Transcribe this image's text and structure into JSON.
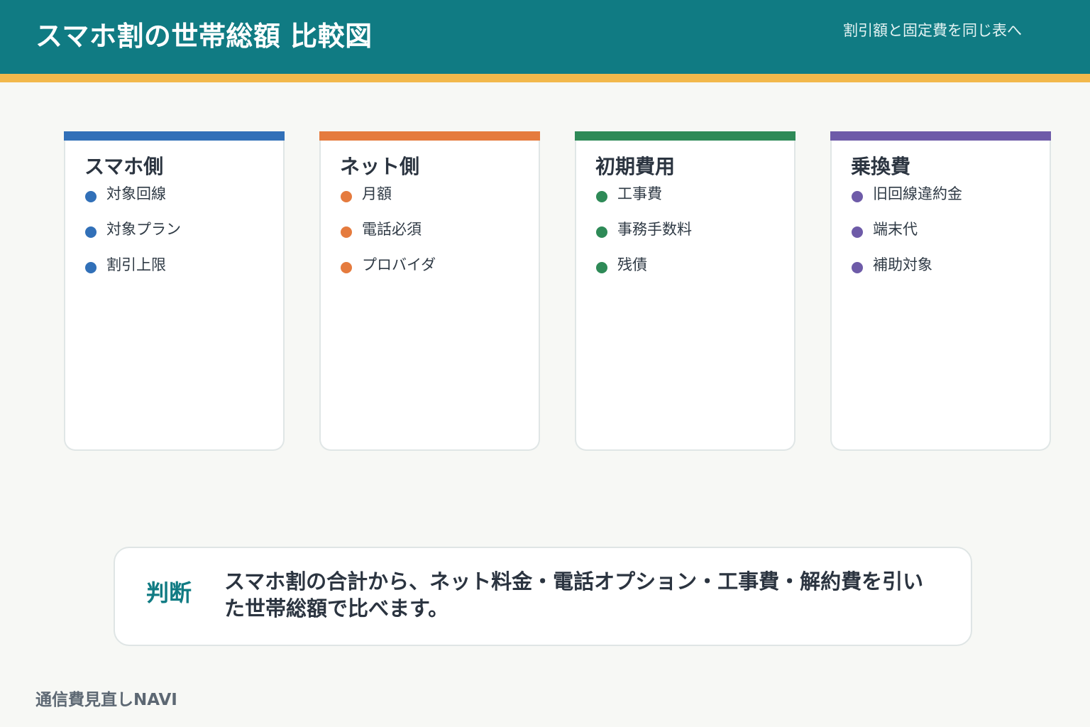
{
  "header": {
    "title": "スマホ割の世帯総額 比較図",
    "subtitle": "割引額と固定費を同じ表へ"
  },
  "cards": [
    {
      "title": "スマホ側",
      "color": "#3170b8",
      "items": [
        "対象回線",
        "対象プラン",
        "割引上限"
      ]
    },
    {
      "title": "ネット側",
      "color": "#e57b3e",
      "items": [
        "月額",
        "電話必須",
        "プロバイダ"
      ]
    },
    {
      "title": "初期費用",
      "color": "#2e8a57",
      "items": [
        "工事費",
        "事務手数料",
        "残債"
      ]
    },
    {
      "title": "乗換費",
      "color": "#6e5ba8",
      "items": [
        "旧回線違約金",
        "端末代",
        "補助対象"
      ]
    }
  ],
  "judgement": {
    "label": "判断",
    "text": "スマホ割の合計から、ネット料金・電話オプション・工事費・解約費を引いた世帯総額で比べます。"
  },
  "footer": {
    "brand": "通信費見直しNAVI"
  },
  "colors": {
    "header_bg": "#107b83",
    "header_stripe": "#f2b84b",
    "page_bg": "#f7f8f5"
  }
}
